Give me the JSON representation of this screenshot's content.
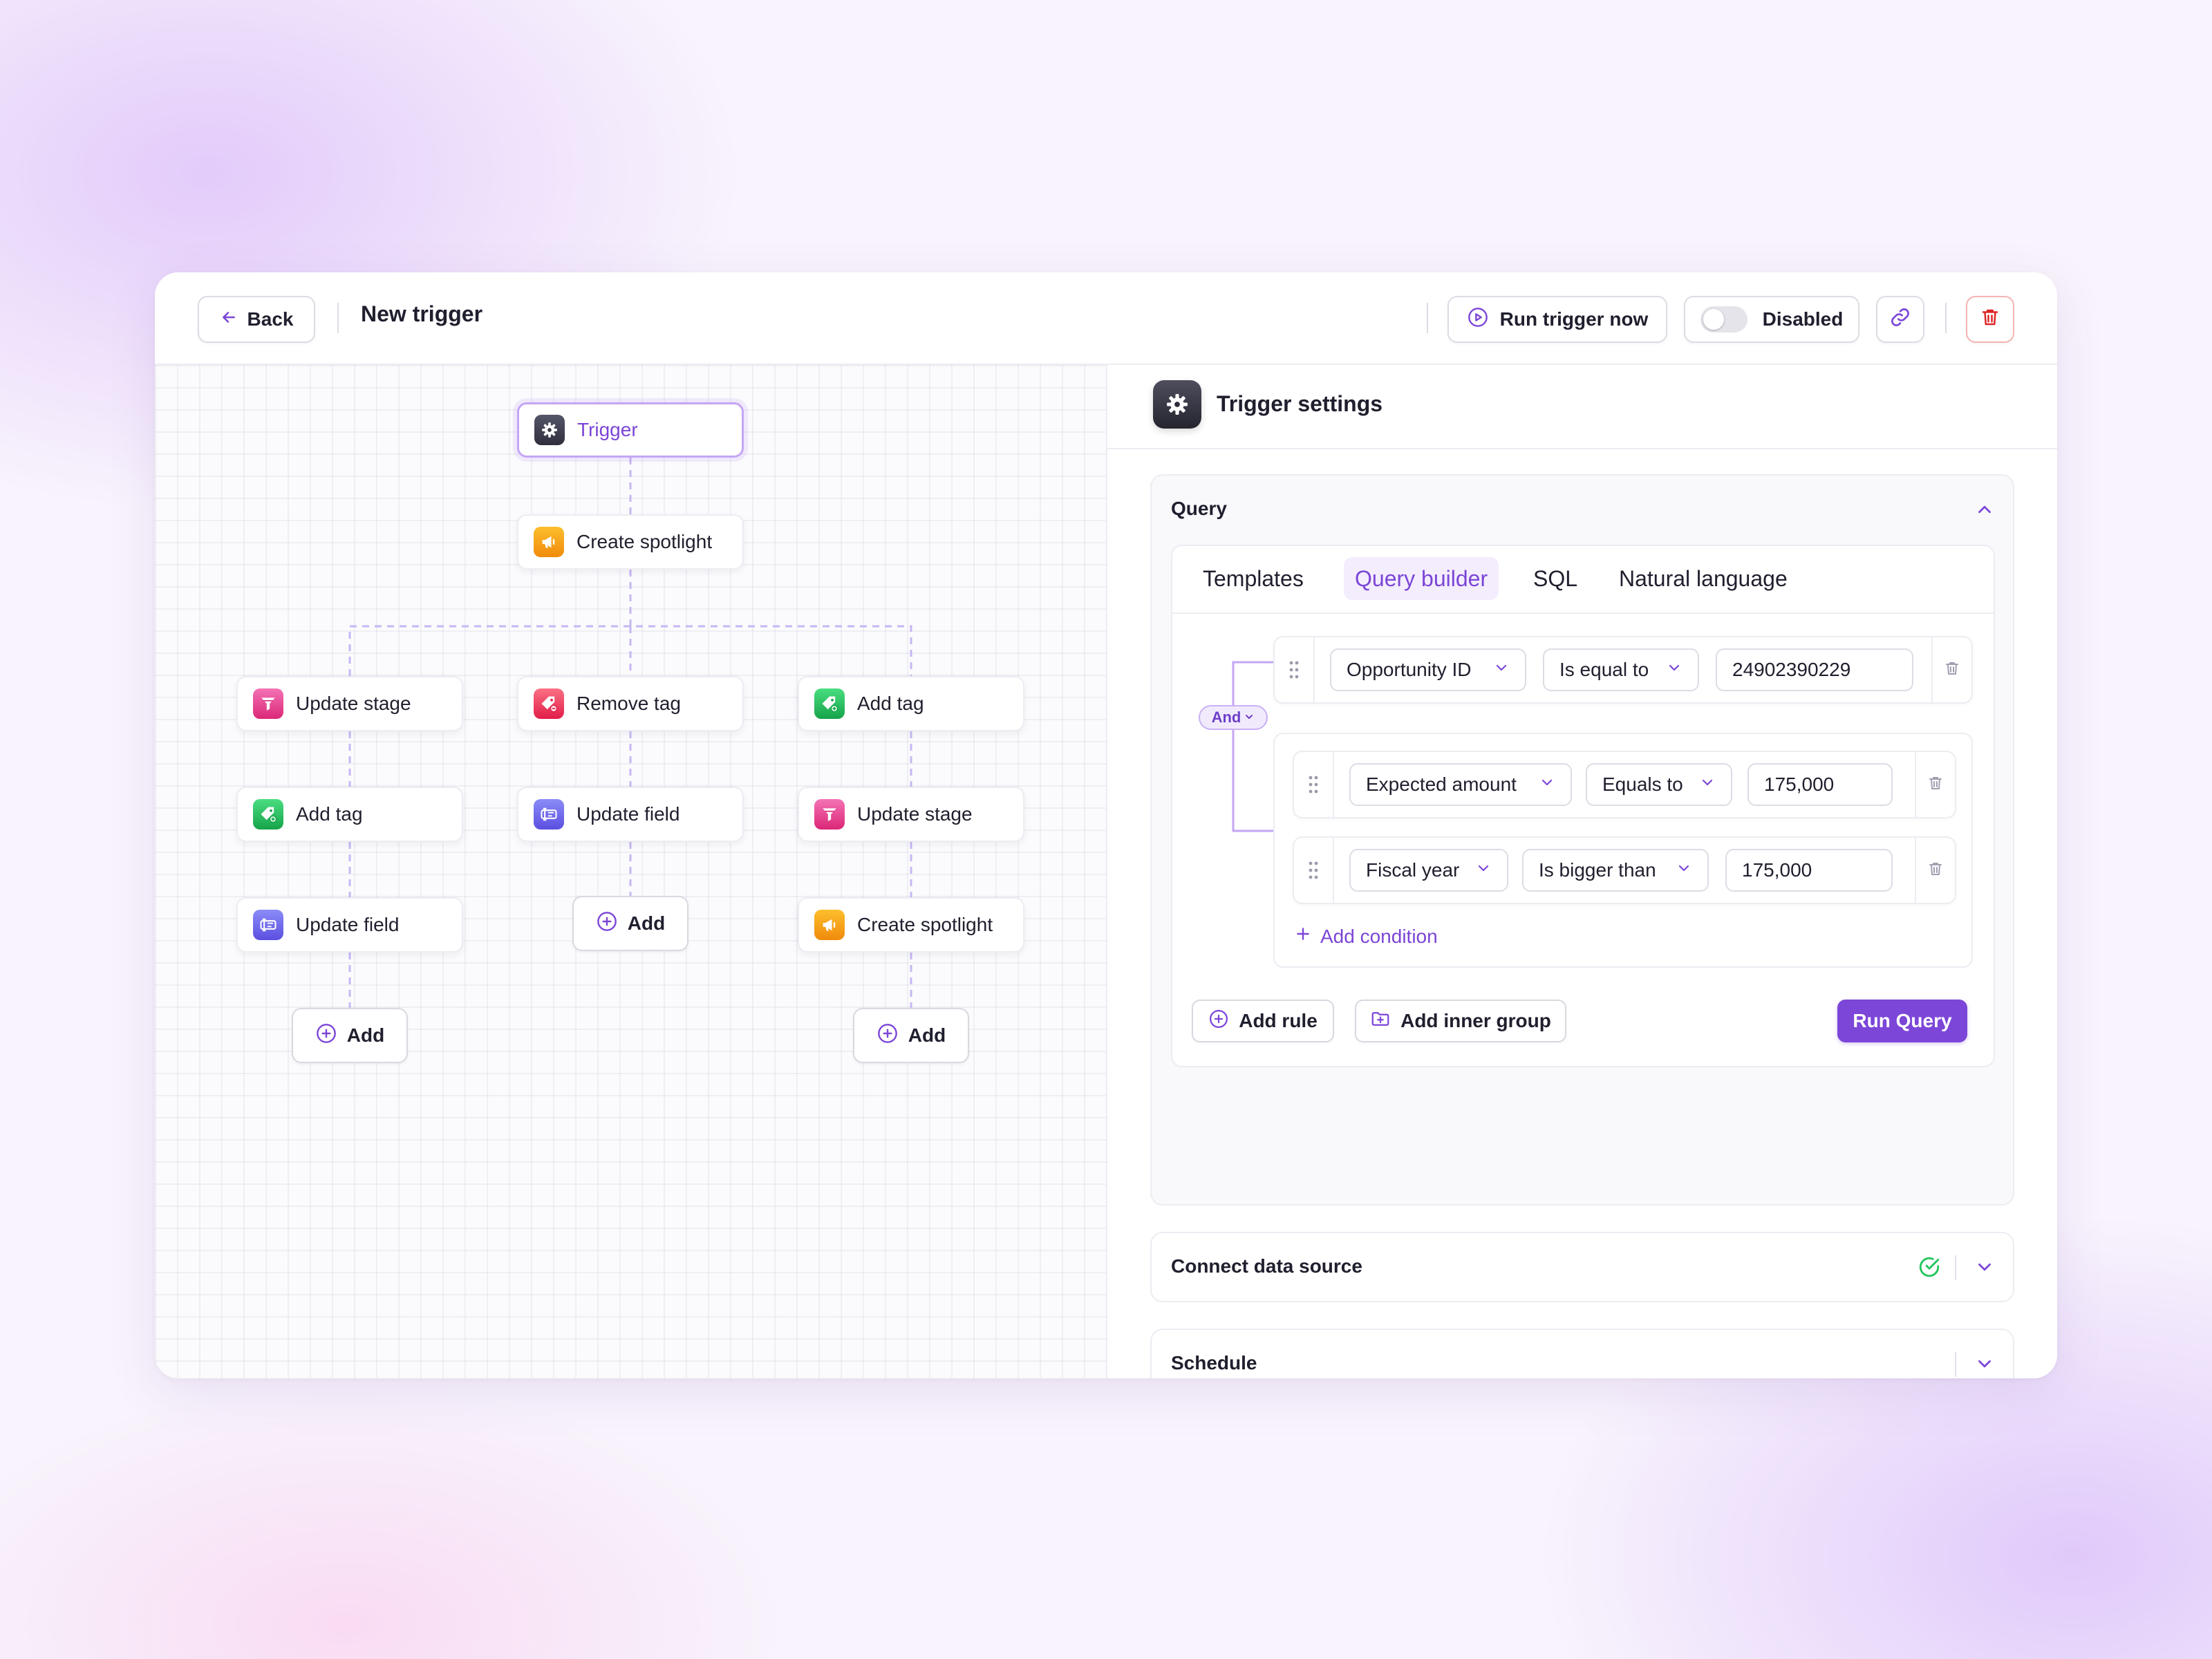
{
  "header": {
    "back_label": "Back",
    "title": "New trigger",
    "run_label": "Run trigger now",
    "toggle_label": "Disabled",
    "toggle_on": false
  },
  "flow": {
    "trigger": "Trigger",
    "root_action": "Create spotlight",
    "columns": [
      {
        "steps": [
          "Update stage",
          "Add tag",
          "Update field"
        ],
        "add_label": "Add"
      },
      {
        "steps": [
          "Remove tag",
          "Update field"
        ],
        "add_label": "Add"
      },
      {
        "steps": [
          "Add tag",
          "Update stage",
          "Create spotlight"
        ],
        "add_label": "Add"
      }
    ]
  },
  "settings": {
    "title": "Trigger settings",
    "query": {
      "label": "Query",
      "tabs": [
        "Templates",
        "Query builder",
        "SQL",
        "Natural language"
      ],
      "active_tab": "Query builder",
      "combinator": "And",
      "rules": [
        {
          "field": "Opportunity ID",
          "operator": "Is equal to",
          "value": "24902390229"
        }
      ],
      "group": {
        "rules": [
          {
            "field": "Expected amount",
            "operator": "Equals to",
            "value": "175,000"
          },
          {
            "field": "Fiscal year",
            "operator": "Is bigger than",
            "value": "175,000"
          }
        ],
        "add_condition_label": "Add condition"
      },
      "add_rule_label": "Add rule",
      "add_group_label": "Add inner group",
      "run_label": "Run Query"
    },
    "connect": {
      "label": "Connect data source",
      "status": "connected"
    },
    "schedule": {
      "label": "Schedule"
    }
  },
  "colors": {
    "accent": "#7c46d8",
    "danger": "#dc2626",
    "success": "#22c55e",
    "connector": "#c7b7f3"
  },
  "icons": {
    "back": "arrow-left-icon",
    "run": "play-circle-icon",
    "link": "link-icon",
    "delete": "trash-icon",
    "settings": "gear-icon",
    "spotlight": "megaphone-icon",
    "stage": "funnel-icon",
    "tag": "tag-icon",
    "field": "text-field-icon",
    "add": "plus-circle-icon",
    "check": "check-circle-icon"
  }
}
